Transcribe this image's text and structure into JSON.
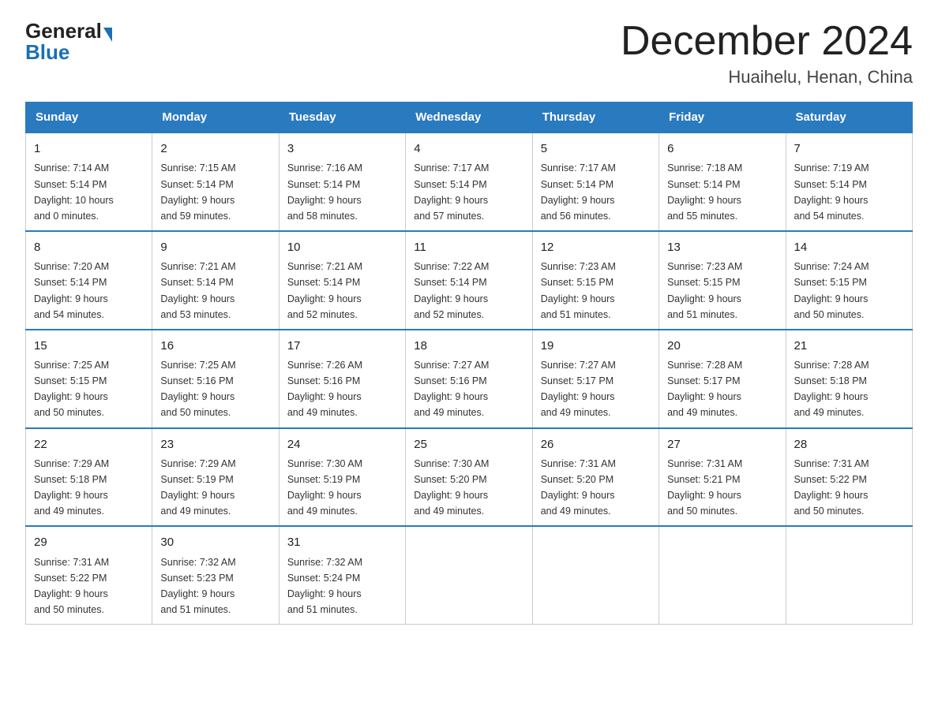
{
  "logo": {
    "general": "General",
    "blue": "Blue"
  },
  "title": "December 2024",
  "location": "Huaihelu, Henan, China",
  "headers": [
    "Sunday",
    "Monday",
    "Tuesday",
    "Wednesday",
    "Thursday",
    "Friday",
    "Saturday"
  ],
  "weeks": [
    [
      {
        "day": "1",
        "sunrise": "7:14 AM",
        "sunset": "5:14 PM",
        "daylight": "10 hours and 0 minutes."
      },
      {
        "day": "2",
        "sunrise": "7:15 AM",
        "sunset": "5:14 PM",
        "daylight": "9 hours and 59 minutes."
      },
      {
        "day": "3",
        "sunrise": "7:16 AM",
        "sunset": "5:14 PM",
        "daylight": "9 hours and 58 minutes."
      },
      {
        "day": "4",
        "sunrise": "7:17 AM",
        "sunset": "5:14 PM",
        "daylight": "9 hours and 57 minutes."
      },
      {
        "day": "5",
        "sunrise": "7:17 AM",
        "sunset": "5:14 PM",
        "daylight": "9 hours and 56 minutes."
      },
      {
        "day": "6",
        "sunrise": "7:18 AM",
        "sunset": "5:14 PM",
        "daylight": "9 hours and 55 minutes."
      },
      {
        "day": "7",
        "sunrise": "7:19 AM",
        "sunset": "5:14 PM",
        "daylight": "9 hours and 54 minutes."
      }
    ],
    [
      {
        "day": "8",
        "sunrise": "7:20 AM",
        "sunset": "5:14 PM",
        "daylight": "9 hours and 54 minutes."
      },
      {
        "day": "9",
        "sunrise": "7:21 AM",
        "sunset": "5:14 PM",
        "daylight": "9 hours and 53 minutes."
      },
      {
        "day": "10",
        "sunrise": "7:21 AM",
        "sunset": "5:14 PM",
        "daylight": "9 hours and 52 minutes."
      },
      {
        "day": "11",
        "sunrise": "7:22 AM",
        "sunset": "5:14 PM",
        "daylight": "9 hours and 52 minutes."
      },
      {
        "day": "12",
        "sunrise": "7:23 AM",
        "sunset": "5:15 PM",
        "daylight": "9 hours and 51 minutes."
      },
      {
        "day": "13",
        "sunrise": "7:23 AM",
        "sunset": "5:15 PM",
        "daylight": "9 hours and 51 minutes."
      },
      {
        "day": "14",
        "sunrise": "7:24 AM",
        "sunset": "5:15 PM",
        "daylight": "9 hours and 50 minutes."
      }
    ],
    [
      {
        "day": "15",
        "sunrise": "7:25 AM",
        "sunset": "5:15 PM",
        "daylight": "9 hours and 50 minutes."
      },
      {
        "day": "16",
        "sunrise": "7:25 AM",
        "sunset": "5:16 PM",
        "daylight": "9 hours and 50 minutes."
      },
      {
        "day": "17",
        "sunrise": "7:26 AM",
        "sunset": "5:16 PM",
        "daylight": "9 hours and 49 minutes."
      },
      {
        "day": "18",
        "sunrise": "7:27 AM",
        "sunset": "5:16 PM",
        "daylight": "9 hours and 49 minutes."
      },
      {
        "day": "19",
        "sunrise": "7:27 AM",
        "sunset": "5:17 PM",
        "daylight": "9 hours and 49 minutes."
      },
      {
        "day": "20",
        "sunrise": "7:28 AM",
        "sunset": "5:17 PM",
        "daylight": "9 hours and 49 minutes."
      },
      {
        "day": "21",
        "sunrise": "7:28 AM",
        "sunset": "5:18 PM",
        "daylight": "9 hours and 49 minutes."
      }
    ],
    [
      {
        "day": "22",
        "sunrise": "7:29 AM",
        "sunset": "5:18 PM",
        "daylight": "9 hours and 49 minutes."
      },
      {
        "day": "23",
        "sunrise": "7:29 AM",
        "sunset": "5:19 PM",
        "daylight": "9 hours and 49 minutes."
      },
      {
        "day": "24",
        "sunrise": "7:30 AM",
        "sunset": "5:19 PM",
        "daylight": "9 hours and 49 minutes."
      },
      {
        "day": "25",
        "sunrise": "7:30 AM",
        "sunset": "5:20 PM",
        "daylight": "9 hours and 49 minutes."
      },
      {
        "day": "26",
        "sunrise": "7:31 AM",
        "sunset": "5:20 PM",
        "daylight": "9 hours and 49 minutes."
      },
      {
        "day": "27",
        "sunrise": "7:31 AM",
        "sunset": "5:21 PM",
        "daylight": "9 hours and 50 minutes."
      },
      {
        "day": "28",
        "sunrise": "7:31 AM",
        "sunset": "5:22 PM",
        "daylight": "9 hours and 50 minutes."
      }
    ],
    [
      {
        "day": "29",
        "sunrise": "7:31 AM",
        "sunset": "5:22 PM",
        "daylight": "9 hours and 50 minutes."
      },
      {
        "day": "30",
        "sunrise": "7:32 AM",
        "sunset": "5:23 PM",
        "daylight": "9 hours and 51 minutes."
      },
      {
        "day": "31",
        "sunrise": "7:32 AM",
        "sunset": "5:24 PM",
        "daylight": "9 hours and 51 minutes."
      },
      null,
      null,
      null,
      null
    ]
  ],
  "sunrise_label": "Sunrise:",
  "sunset_label": "Sunset:",
  "daylight_label": "Daylight:"
}
